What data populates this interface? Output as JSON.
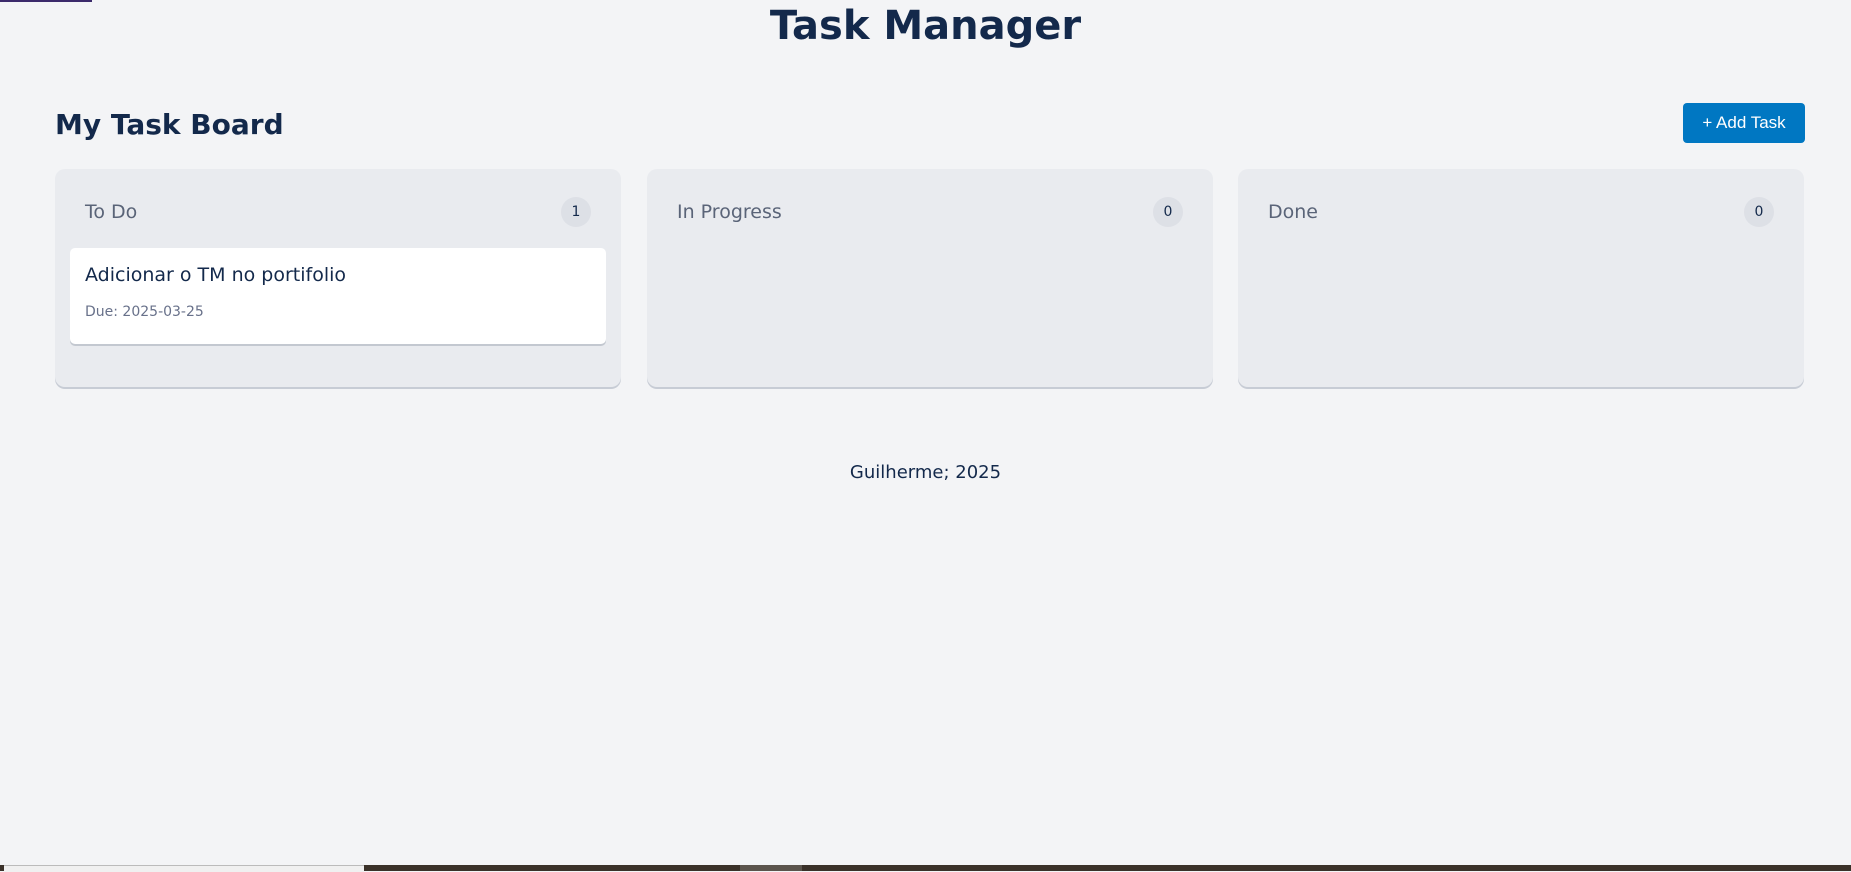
{
  "header": {
    "title": "Task Manager"
  },
  "board": {
    "title": "My Task Board",
    "add_button": "+ Add Task",
    "columns": [
      {
        "title": "To Do",
        "count": "1",
        "tasks": [
          {
            "title": "Adicionar o TM no portifolio",
            "due": "Due: 2025-03-25"
          }
        ]
      },
      {
        "title": "In Progress",
        "count": "0",
        "tasks": []
      },
      {
        "title": "Done",
        "count": "0",
        "tasks": []
      }
    ]
  },
  "footer": {
    "text": "Guilherme; 2025"
  },
  "colors": {
    "accent": "#0077c2",
    "text": "#13294b",
    "background": "#f3f4f6",
    "column": "#e9ebef"
  }
}
